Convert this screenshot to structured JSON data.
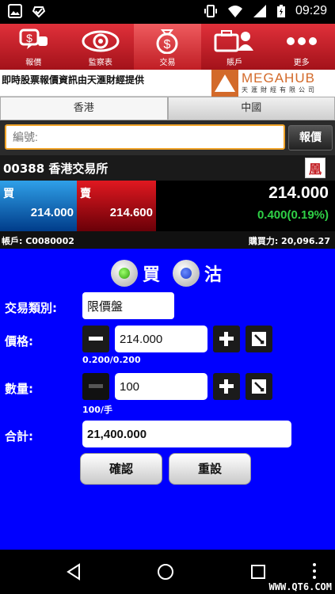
{
  "status": {
    "time": "09:29"
  },
  "tabs": [
    {
      "label": "報價",
      "icon": "quote-icon"
    },
    {
      "label": "監察表",
      "icon": "eye-icon"
    },
    {
      "label": "交易",
      "icon": "money-bag-icon"
    },
    {
      "label": "賬戶",
      "icon": "account-icon"
    },
    {
      "label": "更多",
      "icon": "more-icon"
    }
  ],
  "ticker": {
    "text": "即時股票報價資訊由天滙財經提供",
    "brand": "MEGAHUB",
    "brand_sub": "天滙財經有限公司"
  },
  "markets": [
    "香港",
    "中國"
  ],
  "search": {
    "placeholder": "編號:",
    "button": "報價"
  },
  "stock": {
    "title": "00388 香港交易所",
    "logo_char": "凰"
  },
  "quote": {
    "bid_label": "買",
    "bid_price": "214.000",
    "ask_label": "賣",
    "ask_price": "214.600",
    "last": "214.000",
    "change": "0.400(0.19%)"
  },
  "account": {
    "id": "帳戶: C0080002",
    "buying_power": "購買力: 20,096.27"
  },
  "order": {
    "side_buy": "買",
    "side_sell": "沽",
    "type_label": "交易類別:",
    "type_value": "限價盤",
    "price_label": "價格:",
    "price_value": "214.000",
    "price_spread": "0.200/0.200",
    "qty_label": "數量:",
    "qty_value": "100",
    "lot": "100/手",
    "total_label": "合計:",
    "total_value": "21,400.000",
    "confirm": "確認",
    "reset": "重設"
  },
  "colors": {
    "tab_red": "#c01e25",
    "bid_blue": "#2fa0e8",
    "ask_red": "#e01820",
    "panel_blue": "#0000ff",
    "change_green": "#2fd046",
    "search_border": "#f0a328"
  },
  "watermark": "WWW.QT6.COM"
}
